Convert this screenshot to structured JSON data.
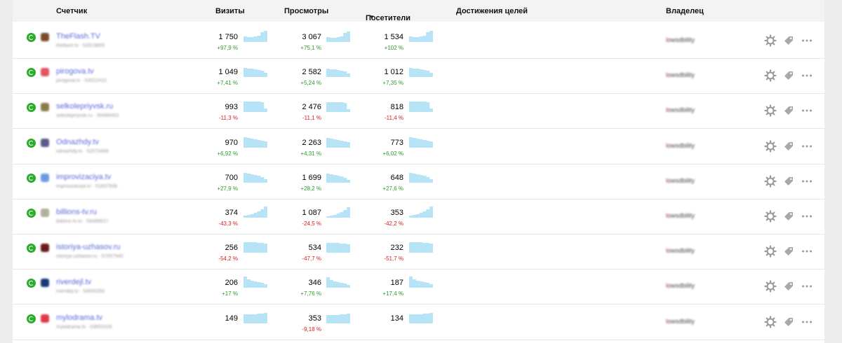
{
  "header": {
    "counter": "Счетчик",
    "visits": "Визиты",
    "views": "Просмотры",
    "visitors": "Посетители",
    "sort_arrow": "▼",
    "goals": "Достижения целей",
    "owner": "Владелец"
  },
  "colors": {
    "status_green": "#2bad2b",
    "link_blue": "#5a6ad8",
    "positive": "#2a9a2a",
    "negative": "#d42020",
    "sparkline": "#b7e3f7"
  },
  "rows": [
    {
      "name": "TheFlash.TV",
      "sub": "theflash.tv · 52619855",
      "favicon": "#7a4a2a",
      "visits": "1 750",
      "visits_pct": "+97,9 %",
      "views": "3 067",
      "views_pct": "+75,1 %",
      "visitors": "1 534",
      "visitors_pct": "+102 %",
      "owner": "lowsdbility",
      "trend": [
        8,
        7,
        7,
        8,
        9,
        14,
        16
      ]
    },
    {
      "name": "pirogova.tv",
      "sub": "pirogova.tv · 53522410",
      "favicon": "#e25563",
      "visits": "1 049",
      "visits_pct": "+7,41 %",
      "views": "2 582",
      "views_pct": "+5,24 %",
      "visitors": "1 012",
      "visitors_pct": "+7,35 %",
      "owner": "lowsdbility",
      "trend": [
        13,
        12,
        12,
        11,
        10,
        9,
        6
      ]
    },
    {
      "name": "selkolepriyvsk.ru",
      "sub": "selkolepriyvsk.ru · 56499463",
      "favicon": "#8a7a4a",
      "visits": "993",
      "visits_pct": "-11,3 %",
      "views": "2 476",
      "views_pct": "-11,1 %",
      "visitors": "818",
      "visitors_pct": "-11,4 %",
      "owner": "lowsdbility",
      "trend": [
        15,
        15,
        15,
        15,
        15,
        14,
        5
      ]
    },
    {
      "name": "Odnazhdy.tv",
      "sub": "odnazhdy.tv · 52073489",
      "favicon": "#5a5a8a",
      "visits": "970",
      "visits_pct": "+6,92 %",
      "views": "2 263",
      "views_pct": "+4,31 %",
      "visitors": "773",
      "visitors_pct": "+6,02 %",
      "owner": "lowsdbility",
      "trend": [
        15,
        14,
        13,
        12,
        11,
        10,
        9
      ]
    },
    {
      "name": "improvizaciya.tv",
      "sub": "improvizaciya.tv · 51837938",
      "favicon": "#6a9ae0",
      "visits": "700",
      "visits_pct": "+27,9 %",
      "views": "1 699",
      "views_pct": "+28,2 %",
      "visitors": "648",
      "visitors_pct": "+27,6 %",
      "owner": "lowsdbility",
      "trend": [
        14,
        13,
        12,
        11,
        10,
        8,
        5
      ]
    },
    {
      "name": "billions-tv.ru",
      "sub": "billions-tv.ru · 56499637",
      "favicon": "#b0b0a0",
      "visits": "374",
      "visits_pct": "-43,3 %",
      "views": "1 087",
      "views_pct": "-24,5 %",
      "visitors": "353",
      "visitors_pct": "-42,2 %",
      "owner": "lowsdbility",
      "trend": [
        3,
        4,
        5,
        7,
        9,
        12,
        16
      ]
    },
    {
      "name": "istoriya-uzhasov.ru",
      "sub": "istoriya-uzhasov.ru · 57057940",
      "favicon": "#6a1a1a",
      "visits": "256",
      "visits_pct": "-54,2 %",
      "views": "534",
      "views_pct": "-47,7 %",
      "visitors": "232",
      "visitors_pct": "-51,7 %",
      "owner": "lowsdbility",
      "trend": [
        15,
        15,
        15,
        15,
        14,
        14,
        13
      ]
    },
    {
      "name": "riverdejl.tv",
      "sub": "riverdejl.tv · 54630260",
      "favicon": "#1a3a7a",
      "visits": "206",
      "visits_pct": "+17 %",
      "views": "346",
      "views_pct": "+7,76 %",
      "visitors": "187",
      "visitors_pct": "+17,4 %",
      "owner": "lowsdbility",
      "trend": [
        16,
        12,
        10,
        9,
        8,
        7,
        5
      ]
    },
    {
      "name": "mylodrama.tv",
      "sub": "mylodrama.tv · 53853329",
      "favicon": "#e03a4a",
      "visits": "149",
      "visits_pct": "",
      "views": "353",
      "views_pct": "-9,18 %",
      "visitors": "134",
      "visitors_pct": "",
      "owner": "lowsdbility",
      "trend": [
        13,
        13,
        13,
        13,
        14,
        14,
        15
      ]
    }
  ],
  "actions": {
    "settings_icon": "gear-icon",
    "label_icon": "tag-icon",
    "more_icon": "more-icon"
  }
}
